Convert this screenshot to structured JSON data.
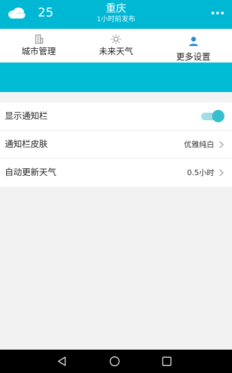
{
  "header": {
    "temperature": "25",
    "city": "重庆",
    "updated": "1小时前发布",
    "weather_icon": "cloud-icon",
    "more_icon": "more-icon"
  },
  "tabs": [
    {
      "label": "城市管理",
      "icon": "building-icon",
      "active": false
    },
    {
      "label": "未来天气",
      "icon": "sun-icon",
      "active": false
    },
    {
      "label": "更多设置",
      "icon": "user-icon",
      "active": true
    }
  ],
  "settings": {
    "notification_bar": {
      "label": "显示通知栏",
      "enabled": true
    },
    "skin": {
      "label": "通知栏皮肤",
      "value": "优雅纯白"
    },
    "auto_update": {
      "label": "自动更新天气",
      "value": "0.5小时"
    }
  },
  "colors": {
    "primary": "#00b8d4",
    "toggle_on": "#35bfcf"
  },
  "navbar": {
    "back_icon": "back-icon",
    "home_icon": "home-icon",
    "recents_icon": "recents-icon"
  }
}
